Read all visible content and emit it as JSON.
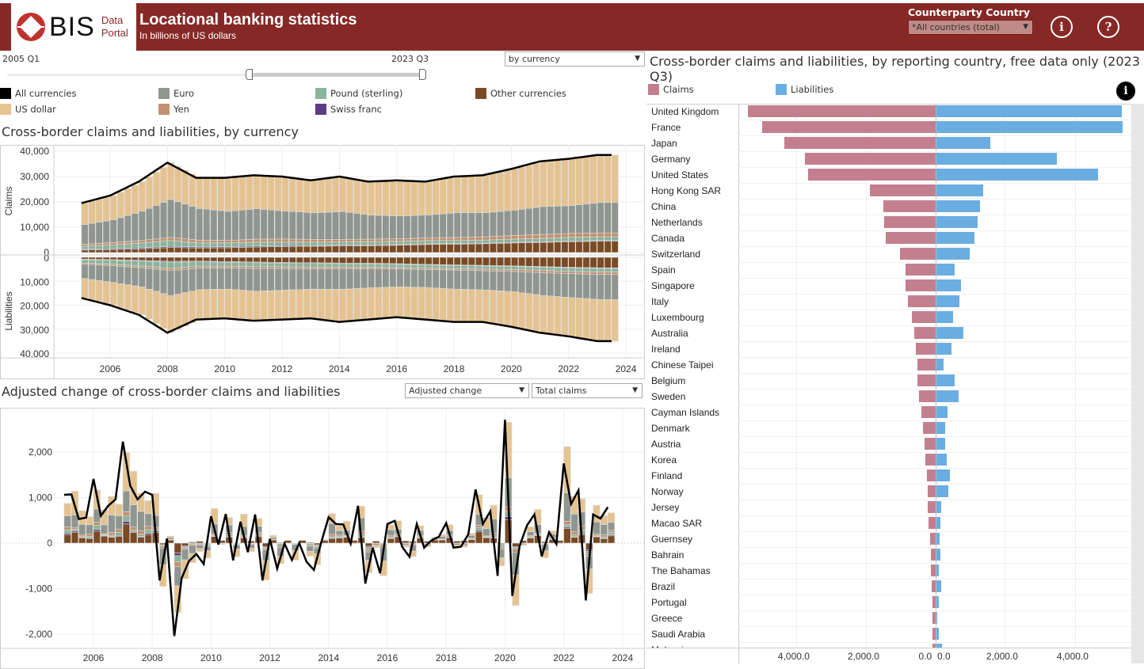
{
  "header": {
    "logo_text": "BIS",
    "logo_sub1": "Data",
    "logo_sub2": "Portal",
    "title": "Locational banking statistics",
    "subtitle": "In billions of US dollars",
    "counterparty_label": "Counterparty Country",
    "counterparty_value": "*All countries (total)",
    "info_icon": "info-icon",
    "help_icon": "help-icon"
  },
  "controls": {
    "range_start": "2005 Q1",
    "range_end": "2023 Q3",
    "breakdown_select": "by currency"
  },
  "colors": {
    "header": "#862926",
    "all": "#000000",
    "euro": "#8f9690",
    "pound": "#8ab49b",
    "other": "#7a4a24",
    "usd": "#e5c391",
    "yen": "#c29170",
    "chf": "#5e3c82",
    "claims": "#c37f8e",
    "liabilities": "#6aade1"
  },
  "legend": [
    {
      "key": "all",
      "label": "All currencies"
    },
    {
      "key": "euro",
      "label": "Euro"
    },
    {
      "key": "pound",
      "label": "Pound (sterling)"
    },
    {
      "key": "other",
      "label": "Other currencies"
    },
    {
      "key": "usd",
      "label": "US dollar"
    },
    {
      "key": "yen",
      "label": "Yen"
    },
    {
      "key": "chf",
      "label": "Swiss franc"
    }
  ],
  "chart_data": [
    {
      "type": "bar",
      "title": "Cross-border claims and liabilities, by currency",
      "stacked": true,
      "ylabel_top": "Claims",
      "ylabel_bottom": "Liabilities",
      "yticks": [
        "40,000",
        "30,000",
        "20,000",
        "10,000",
        "0"
      ],
      "xticks": [
        "2006",
        "2008",
        "2010",
        "2012",
        "2014",
        "2016",
        "2018",
        "2020",
        "2022",
        "2024"
      ],
      "years": [
        2005,
        2006,
        2007,
        2008,
        2009,
        2010,
        2011,
        2012,
        2013,
        2014,
        2015,
        2016,
        2017,
        2018,
        2019,
        2020,
        2021,
        2022,
        2023
      ],
      "claims": {
        "other": [
          1000,
          1200,
          1500,
          2000,
          1800,
          1900,
          2200,
          2400,
          2500,
          2600,
          2700,
          2900,
          3200,
          3300,
          3500,
          3800,
          4000,
          4300,
          4500
        ],
        "chf": [
          300,
          350,
          400,
          450,
          400,
          400,
          400,
          350,
          300,
          300,
          300,
          250,
          250,
          250,
          250,
          250,
          250,
          250,
          250
        ],
        "pound": [
          1200,
          1500,
          1900,
          2300,
          1600,
          1500,
          1500,
          1400,
          1300,
          1300,
          1300,
          1300,
          1300,
          1200,
          1200,
          1300,
          1400,
          1500,
          1500
        ],
        "yen": [
          800,
          900,
          1000,
          1200,
          1100,
          1000,
          1200,
          1200,
          1100,
          1000,
          1000,
          1000,
          1100,
          1200,
          1300,
          1400,
          1500,
          1500,
          1500
        ],
        "euro": [
          7800,
          9000,
          11500,
          15000,
          12500,
          11500,
          12000,
          11000,
          10500,
          11000,
          9500,
          9000,
          9000,
          9800,
          9500,
          10000,
          11000,
          11000,
          12000
        ],
        "usd": [
          8400,
          9550,
          11700,
          14550,
          12100,
          13200,
          13200,
          13650,
          12800,
          13800,
          13200,
          14050,
          13150,
          14250,
          14750,
          16250,
          17850,
          18450,
          18750
        ]
      },
      "liabilities": {
        "other": [
          800,
          1000,
          1300,
          1700,
          1600,
          1800,
          2000,
          2200,
          2300,
          2400,
          2500,
          2700,
          3000,
          3200,
          3400,
          3600,
          3900,
          4200,
          4400
        ],
        "chf": [
          200,
          250,
          300,
          350,
          300,
          300,
          300,
          300,
          300,
          300,
          250,
          250,
          250,
          250,
          250,
          250,
          250,
          250,
          250
        ],
        "pound": [
          1400,
          1700,
          2100,
          2600,
          1800,
          1600,
          1600,
          1500,
          1500,
          1500,
          1400,
          1300,
          1300,
          1300,
          1300,
          1300,
          1400,
          1500,
          1500
        ],
        "yen": [
          500,
          600,
          700,
          900,
          800,
          800,
          800,
          700,
          700,
          700,
          600,
          600,
          600,
          600,
          700,
          800,
          900,
          900,
          1000
        ],
        "euro": [
          6000,
          7000,
          8000,
          10500,
          9000,
          8800,
          9500,
          9000,
          8500,
          8500,
          8000,
          7500,
          7500,
          8000,
          8000,
          8500,
          9500,
          10000,
          10500
        ],
        "usd": [
          8100,
          9450,
          11600,
          15450,
          12500,
          12200,
          12300,
          12300,
          12200,
          13600,
          13250,
          12650,
          13350,
          13650,
          13350,
          14550,
          15550,
          16150,
          17350
        ]
      }
    },
    {
      "type": "bar",
      "title": "Adjusted change of cross-border claims and liabilities",
      "measure_select": "Adjusted change",
      "position_select": "Total claims",
      "yticks": [
        "2,000",
        "1,000",
        "0",
        "-1,000",
        "-2,000"
      ],
      "xticks": [
        "2006",
        "2008",
        "2010",
        "2012",
        "2014",
        "2016",
        "2018",
        "2020",
        "2022",
        "2024"
      ],
      "start": "2005 Q1",
      "total": [
        1060,
        1070,
        530,
        560,
        1410,
        600,
        820,
        960,
        2230,
        1260,
        960,
        1130,
        1060,
        -820,
        100,
        -2040,
        -770,
        -390,
        -240,
        -460,
        590,
        -30,
        640,
        -380,
        470,
        -200,
        630,
        -820,
        90,
        -560,
        -10,
        -370,
        0,
        -410,
        -590,
        20,
        570,
        420,
        410,
        -10,
        820,
        -890,
        -100,
        -660,
        420,
        490,
        -80,
        -300,
        420,
        -100,
        60,
        140,
        440,
        -100,
        -80,
        190,
        1180,
        420,
        700,
        -720,
        2710,
        -1160,
        -60,
        390,
        630,
        -290,
        240,
        -20,
        1750,
        860,
        1160,
        -1260,
        630,
        540,
        790
      ]
    },
    {
      "type": "bar",
      "title": "Cross-border claims and liabilities, by reporting country, free data only (2023 Q3)",
      "series_names": [
        "Claims",
        "Liabilities"
      ],
      "xticks_left": [
        "4,000.0",
        "2,000.0",
        "0.0"
      ],
      "xticks_right": [
        "0.0",
        "2,000.0",
        "4,000.0"
      ],
      "countries": [
        {
          "name": "United Kingdom",
          "claims": 5380,
          "liabilities": 5320
        },
        {
          "name": "France",
          "claims": 4980,
          "liabilities": 5340
        },
        {
          "name": "Japan",
          "claims": 4340,
          "liabilities": 1550
        },
        {
          "name": "Germany",
          "claims": 3750,
          "liabilities": 3450
        },
        {
          "name": "United States",
          "claims": 3660,
          "liabilities": 4640
        },
        {
          "name": "Hong Kong SAR",
          "claims": 1890,
          "liabilities": 1340
        },
        {
          "name": "China",
          "claims": 1500,
          "liabilities": 1250
        },
        {
          "name": "Netherlands",
          "claims": 1480,
          "liabilities": 1180
        },
        {
          "name": "Canada",
          "claims": 1430,
          "liabilities": 1090
        },
        {
          "name": "Switzerland",
          "claims": 1020,
          "liabilities": 950
        },
        {
          "name": "Spain",
          "claims": 860,
          "liabilities": 520
        },
        {
          "name": "Singapore",
          "claims": 860,
          "liabilities": 700
        },
        {
          "name": "Italy",
          "claims": 800,
          "liabilities": 660
        },
        {
          "name": "Luxembourg",
          "claims": 680,
          "liabilities": 480
        },
        {
          "name": "Australia",
          "claims": 610,
          "liabilities": 770
        },
        {
          "name": "Ireland",
          "claims": 570,
          "liabilities": 430
        },
        {
          "name": "Chinese Taipei",
          "claims": 520,
          "liabilities": 200
        },
        {
          "name": "Belgium",
          "claims": 520,
          "liabilities": 520
        },
        {
          "name": "Sweden",
          "claims": 480,
          "liabilities": 640
        },
        {
          "name": "Cayman Islands",
          "claims": 410,
          "liabilities": 320
        },
        {
          "name": "Denmark",
          "claims": 360,
          "liabilities": 250
        },
        {
          "name": "Austria",
          "claims": 320,
          "liabilities": 250
        },
        {
          "name": "Korea",
          "claims": 300,
          "liabilities": 300
        },
        {
          "name": "Finland",
          "claims": 250,
          "liabilities": 390
        },
        {
          "name": "Norway",
          "claims": 230,
          "liabilities": 340
        },
        {
          "name": "Jersey",
          "claims": 230,
          "liabilities": 140
        },
        {
          "name": "Macao SAR",
          "claims": 200,
          "liabilities": 110
        },
        {
          "name": "Guernsey",
          "claims": 160,
          "liabilities": 90
        },
        {
          "name": "Bahrain",
          "claims": 140,
          "liabilities": 110
        },
        {
          "name": "The Bahamas",
          "claims": 140,
          "liabilities": 70
        },
        {
          "name": "Brazil",
          "claims": 110,
          "liabilities": 140
        },
        {
          "name": "Portugal",
          "claims": 90,
          "liabilities": 70
        },
        {
          "name": "Greece",
          "claims": 90,
          "liabilities": 20
        },
        {
          "name": "Saudi Arabia",
          "claims": 90,
          "liabilities": 70
        },
        {
          "name": "Malaysia",
          "claims": 80,
          "liabilities": 150
        }
      ]
    }
  ]
}
